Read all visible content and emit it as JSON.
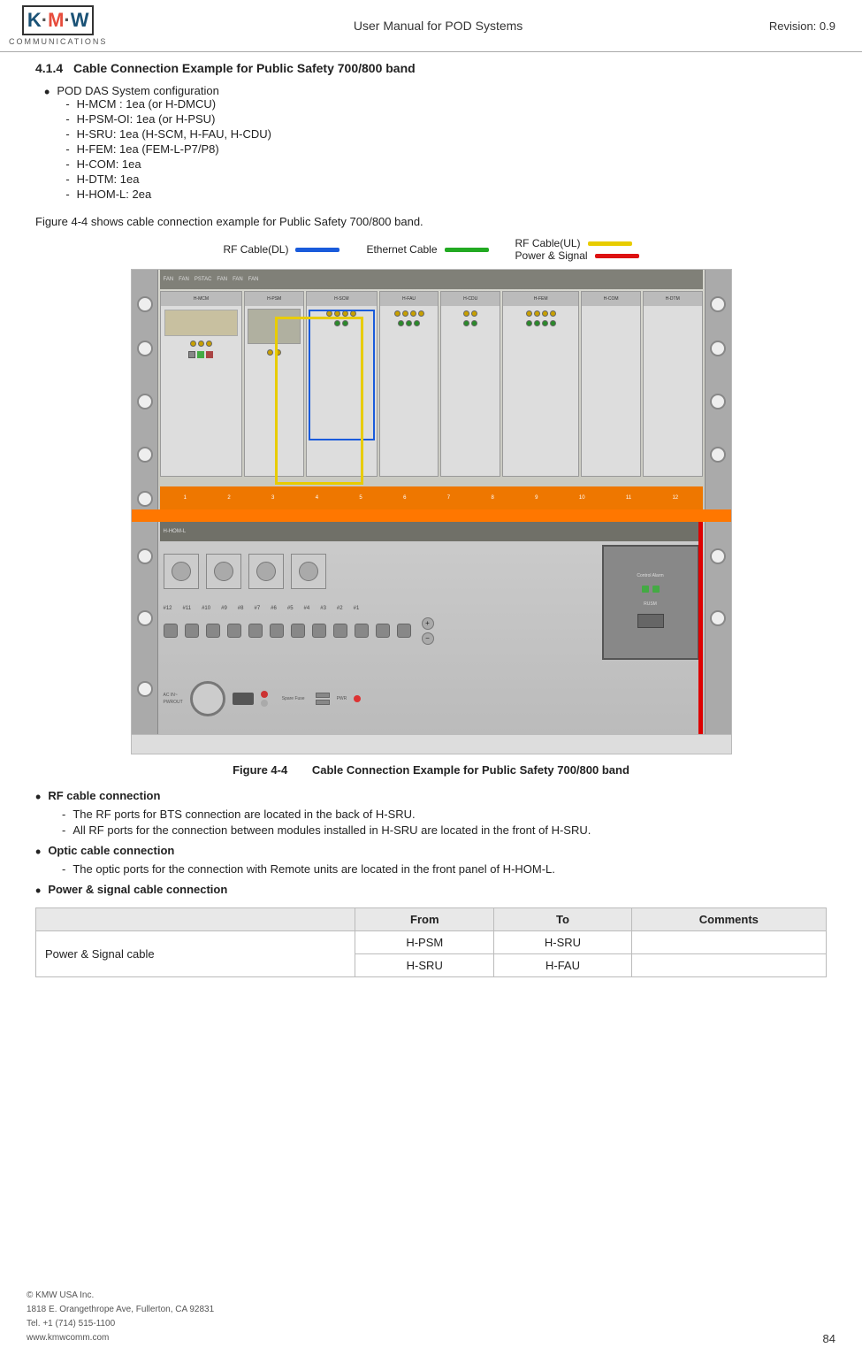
{
  "header": {
    "logo_letters": [
      "K",
      ".",
      "M",
      "W"
    ],
    "logo_subtitle": "COMMUNICATIONS",
    "center_title": "User Manual for POD Systems",
    "revision": "Revision: 0.9"
  },
  "section": {
    "number": "4.1.4",
    "title": "Cable Connection Example for Public Safety 700/800 band"
  },
  "config_heading": "POD DAS System configuration",
  "config_items": [
    "H-MCM : 1ea (or H-DMCU)",
    "H-PSM-OI: 1ea (or H-PSU)",
    "H-SRU: 1ea (H-SCM, H-FAU, H-CDU)",
    "H-FEM: 1ea (FEM-L-P7/P8)",
    "H-COM: 1ea",
    "H-DTM: 1ea",
    "H-HOM-L: 2ea"
  ],
  "figure_intro": "Figure 4-4 shows cable connection example for Public Safety 700/800 band.",
  "legend": {
    "rf_dl_label": "RF Cable(DL)",
    "rf_dl_color": "#1a5bdb",
    "rf_ul_label": "RF Cable(UL)",
    "rf_ul_color": "#e8cc00",
    "ethernet_label": "Ethernet Cable",
    "ethernet_color": "#22aa22",
    "power_label": "Power & Signal",
    "power_color": "#dd1111"
  },
  "figure_caption": {
    "number": "Figure 4-4",
    "title": "Cable Connection Example for Public Safety 700/800 band"
  },
  "bullets": {
    "rf_heading": "RF cable connection",
    "rf_items": [
      "The RF ports for BTS connection are located in the back of H-SRU.",
      "All RF ports for the connection between modules installed in H-SRU are located in the front of H-SRU."
    ],
    "optic_heading": "Optic cable connection",
    "optic_items": [
      "The optic ports for the connection with Remote units are located in the front panel of H-HOM-L."
    ],
    "power_heading": "Power & signal cable connection"
  },
  "table": {
    "headers": [
      "",
      "From",
      "To",
      "Comments"
    ],
    "rows": [
      {
        "label": "Power & Signal cable",
        "row1_from": "H-PSM",
        "row1_to": "H-SRU",
        "row1_comment": ""
      },
      {
        "label": "",
        "row2_from": "H-SRU",
        "row2_to": "H-FAU",
        "row2_comment": ""
      }
    ]
  },
  "footer": {
    "company": "© KMW USA Inc.",
    "address": "1818 E. Orangethrope Ave, Fullerton, CA 92831",
    "tel": "Tel. +1 (714) 515-1100",
    "website": "www.kmwcomm.com",
    "page_number": "84"
  }
}
